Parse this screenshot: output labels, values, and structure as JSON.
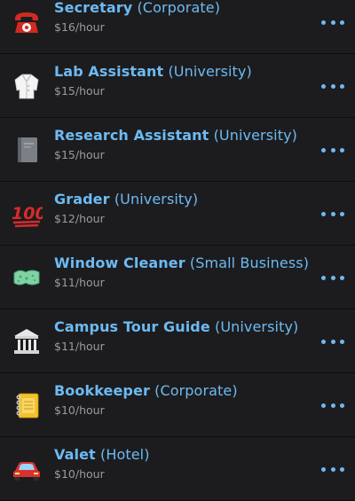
{
  "jobs": [
    {
      "title": "Secretary",
      "employer": "(Corporate)",
      "pay": "$16/hour",
      "icon": "telephone-icon"
    },
    {
      "title": "Lab Assistant",
      "employer": "(University)",
      "pay": "$15/hour",
      "icon": "lab-coat-icon"
    },
    {
      "title": "Research Assistant",
      "employer": "(University)",
      "pay": "$15/hour",
      "icon": "notebook-icon"
    },
    {
      "title": "Grader",
      "employer": "(University)",
      "pay": "$12/hour",
      "icon": "hundred-points-icon"
    },
    {
      "title": "Window Cleaner",
      "employer": "(Small Business)",
      "pay": "$11/hour",
      "icon": "sponge-icon"
    },
    {
      "title": "Campus Tour Guide",
      "employer": "(University)",
      "pay": "$11/hour",
      "icon": "classical-building-icon"
    },
    {
      "title": "Bookkeeper",
      "employer": "(Corporate)",
      "pay": "$10/hour",
      "icon": "spiral-notepad-icon"
    },
    {
      "title": "Valet",
      "employer": "(Hotel)",
      "pay": "$10/hour",
      "icon": "car-icon"
    }
  ],
  "colors": {
    "background": "#1c1c1e",
    "accent": "#6dbaf3",
    "secondary_text": "#9a9aa0"
  }
}
